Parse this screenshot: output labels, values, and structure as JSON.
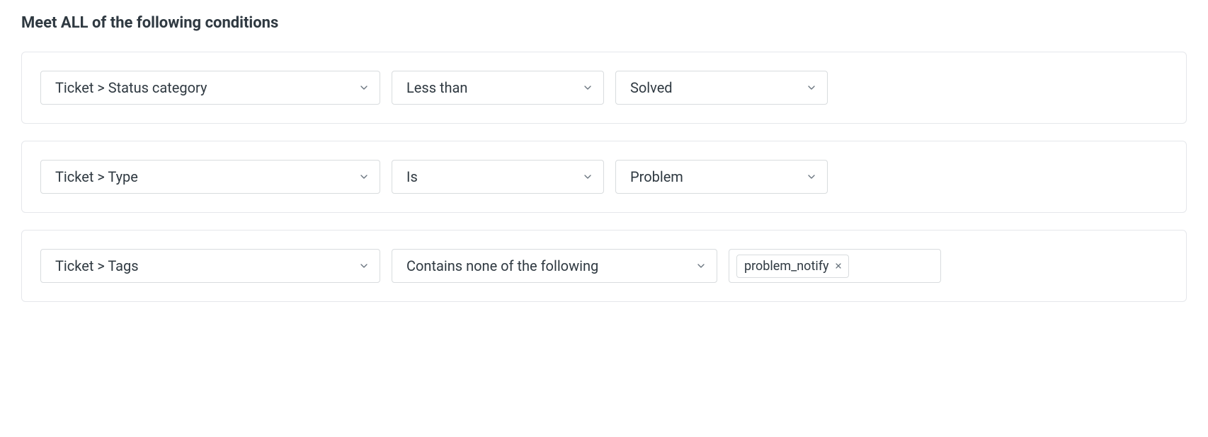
{
  "section": {
    "title": "Meet ALL of the following conditions"
  },
  "conditions": [
    {
      "field": "Ticket > Status category",
      "operator": "Less than",
      "value": "Solved"
    },
    {
      "field": "Ticket > Type",
      "operator": "Is",
      "value": "Problem"
    },
    {
      "field": "Ticket > Tags",
      "operator": "Contains none of the following",
      "tags": [
        "problem_notify"
      ]
    }
  ]
}
